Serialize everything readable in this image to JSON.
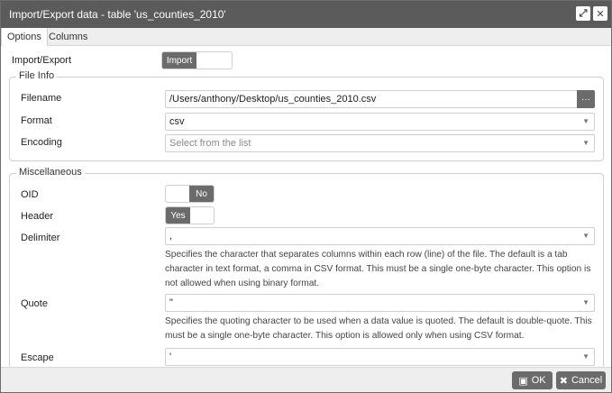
{
  "window": {
    "title": "Import/Export data - table 'us_counties_2010'",
    "maximize_icon": "expand-icon",
    "close_icon": "close-icon"
  },
  "tabs": [
    {
      "label": "Options",
      "active": true
    },
    {
      "label": "Columns",
      "active": false
    }
  ],
  "import_export": {
    "label": "Import/Export",
    "value": "Import"
  },
  "file_info": {
    "legend": "File Info",
    "filename_label": "Filename",
    "filename_value": "/Users/anthony/Desktop/us_counties_2010.csv",
    "browse_label": "···",
    "format_label": "Format",
    "format_value": "csv",
    "encoding_label": "Encoding",
    "encoding_placeholder": "Select from the list"
  },
  "misc": {
    "legend": "Miscellaneous",
    "oid_label": "OID",
    "oid_value": "No",
    "header_label": "Header",
    "header_value": "Yes",
    "delimiter_label": "Delimiter",
    "delimiter_value": ",",
    "delimiter_help": "Specifies the character that separates columns within each row (line) of the file. The default is a tab character in text format, a comma in CSV format. This must be a single one-byte character. This option is not allowed when using binary format.",
    "quote_label": "Quote",
    "quote_value": "\"",
    "quote_help": "Specifies the quoting character to be used when a data value is quoted. The default is double-quote. This must be a single one-byte character. This option is allowed only when using CSV format.",
    "escape_label": "Escape",
    "escape_value": "'"
  },
  "footer": {
    "ok_label": "OK",
    "cancel_label": "Cancel"
  }
}
